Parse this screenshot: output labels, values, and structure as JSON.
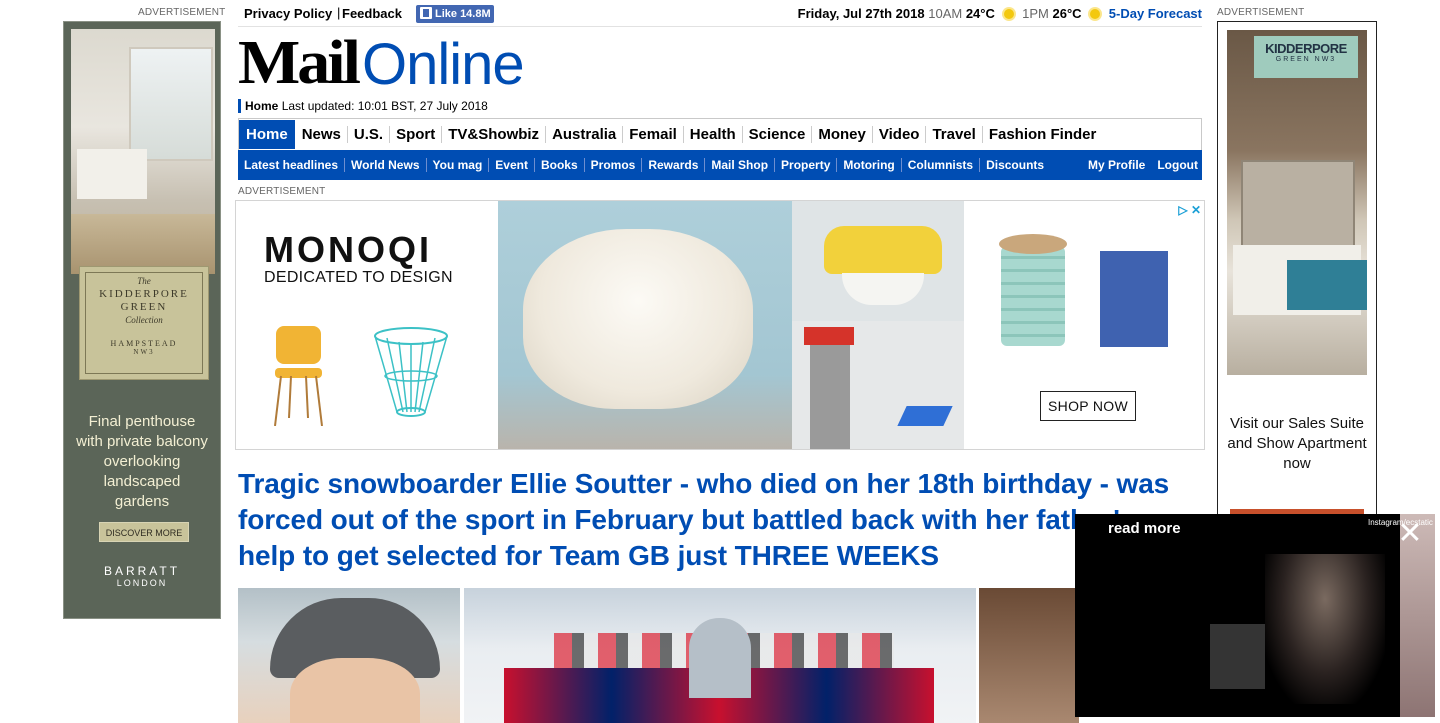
{
  "header": {
    "privacy_label": "Privacy Policy",
    "feedback_label": "Feedback",
    "fb_like_label": "Like 14.8M",
    "date": "Friday, Jul 27th 2018",
    "weather_time1": "10AM",
    "weather_temp1": "24°C",
    "weather_time2": "1PM",
    "weather_temp2": "26°C",
    "forecast_label": "5-Day Forecast"
  },
  "logo": {
    "mail": "Mail",
    "online": "Online"
  },
  "updated": {
    "home": "Home",
    "text": "Last updated: 10:01 BST, 27 July 2018"
  },
  "nav": {
    "items": [
      "Home",
      "News",
      "U.S.",
      "Sport",
      "TV&Showbiz",
      "Australia",
      "Femail",
      "Health",
      "Science",
      "Money",
      "Video",
      "Travel",
      "Fashion Finder"
    ],
    "active_index": 0
  },
  "subnav": {
    "items": [
      "Latest headlines",
      "World News",
      "You mag",
      "Event",
      "Books",
      "Promos",
      "Rewards",
      "Mail Shop",
      "Property",
      "Motoring",
      "Columnists",
      "Discounts"
    ],
    "right": [
      "My Profile",
      "Logout"
    ]
  },
  "ads": {
    "label": "ADVERTISEMENT",
    "left": {
      "badge_line1": "The",
      "badge_line2": "KIDDERPORE GREEN",
      "badge_line3": "Collection",
      "badge_line4": "HAMPSTEAD",
      "badge_line5": "NW3",
      "copy": "Final penthouse with private balcony overlooking landscaped gardens",
      "button": "DISCOVER MORE",
      "brand": "BARRATT",
      "brand_sub": "LONDON"
    },
    "right": {
      "tag_title": "KIDDERPORE",
      "tag_sub": "GREEN NW3",
      "copy": "Visit our Sales Suite and Show Apartment now"
    },
    "banner": {
      "brand": "MONOQI",
      "tagline": "DEDICATED TO DESIGN",
      "cta": "SHOP NOW"
    }
  },
  "article": {
    "headline": "Tragic snowboarder Ellie Soutter - who died on her 18th birthday - was forced out of the sport in February but battled back with her father's help to get selected for Team GB just THREE WEEKS"
  },
  "video": {
    "read_more": "read more",
    "credit": "Instagram/ecstatic"
  },
  "colors": {
    "brand_blue": "#004db3",
    "ad_green": "#5b6558"
  }
}
